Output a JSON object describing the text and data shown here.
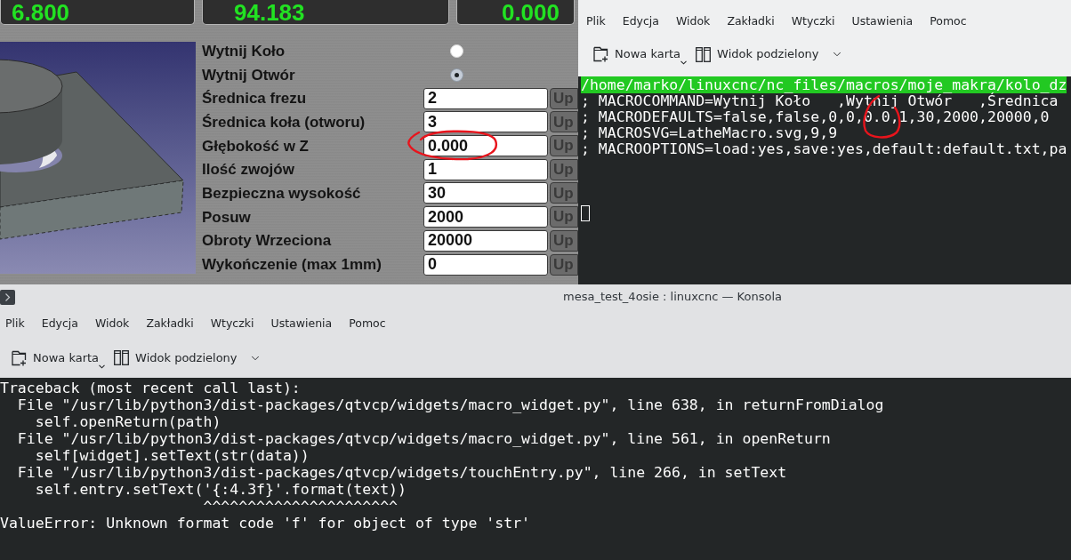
{
  "linuxcnc_panel": {
    "dro_readouts": [
      {
        "value": "6.800"
      },
      {
        "value": "94.183"
      },
      {
        "value": "0.000"
      }
    ],
    "macro_form": [
      {
        "kind": "radio",
        "label": "Wytnij Koło",
        "selected": false
      },
      {
        "kind": "radio",
        "label": "Wytnij Otwór",
        "selected": true
      },
      {
        "kind": "entry",
        "label": "Średnica frezu",
        "value": "2",
        "button": "Up"
      },
      {
        "kind": "entry",
        "label": "Średnica koła (otworu)",
        "value": "3",
        "button": "Up"
      },
      {
        "kind": "entry",
        "label": "Głębokość w Z",
        "value": "0.000",
        "button": "Up"
      },
      {
        "kind": "entry",
        "label": "Ilość zwojów",
        "value": "1",
        "button": "Up"
      },
      {
        "kind": "entry",
        "label": "Bezpieczna wysokość",
        "value": "30",
        "button": "Up"
      },
      {
        "kind": "entry",
        "label": "Posuw",
        "value": "2000",
        "button": "Up"
      },
      {
        "kind": "entry",
        "label": "Obroty Wrzeciona",
        "value": "20000",
        "button": "Up"
      },
      {
        "kind": "entry",
        "label": "Wykończenie (max 1mm)",
        "value": "0",
        "button": "Up"
      }
    ]
  },
  "konsole_top": {
    "menu": [
      "Plik",
      "Edycja",
      "Widok",
      "Zakładki",
      "Wtyczki",
      "Ustawienia",
      "Pomoc"
    ],
    "toolbar": [
      {
        "label": "Nowa karta"
      },
      {
        "label": "Widok podzielony"
      }
    ],
    "terminal": [
      {
        "text": "/home/marko/linuxcnc/nc_files/macros/moje_makra/kolo_dz",
        "highlighted": true
      },
      {
        "text": "; MACROCOMMAND=Wytnij Koło   ,Wytnij Otwór   ,Średnica",
        "highlighted": false
      },
      {
        "text": "; MACRODEFAULTS=false,false,0,0,0.0,1,30,2000,20000,0",
        "highlighted": false
      },
      {
        "text": "; MACROSVG=LatheMacro.svg,9,9",
        "highlighted": false
      },
      {
        "text": "; MACROOPTIONS=load:yes,save:yes,default:default.txt,pa",
        "highlighted": false
      }
    ]
  },
  "konsole_bottom": {
    "window": {
      "title": "mesa_test_4osie : linuxcnc — Konsola"
    },
    "menu": [
      "Plik",
      "Edycja",
      "Widok",
      "Zakładki",
      "Wtyczki",
      "Ustawienia",
      "Pomoc"
    ],
    "toolbar": [
      {
        "label": "Nowa karta"
      },
      {
        "label": "Widok podzielony"
      }
    ],
    "terminal": [
      "Traceback (most recent call last):",
      "  File \"/usr/lib/python3/dist-packages/qtvcp/widgets/macro_widget.py\", line 638, in returnFromDialog",
      "    self.openReturn(path)",
      "  File \"/usr/lib/python3/dist-packages/qtvcp/widgets/macro_widget.py\", line 561, in openReturn",
      "    self[widget].setText(str(data))",
      "  File \"/usr/lib/python3/dist-packages/qtvcp/widgets/touchEntry.py\", line 266, in setText",
      "    self.entry.setText('{:4.3f}'.format(text))",
      "                       ^^^^^^^^^^^^^^^^^^^^^^",
      "ValueError: Unknown format code 'f' for object of type 'str'"
    ]
  }
}
